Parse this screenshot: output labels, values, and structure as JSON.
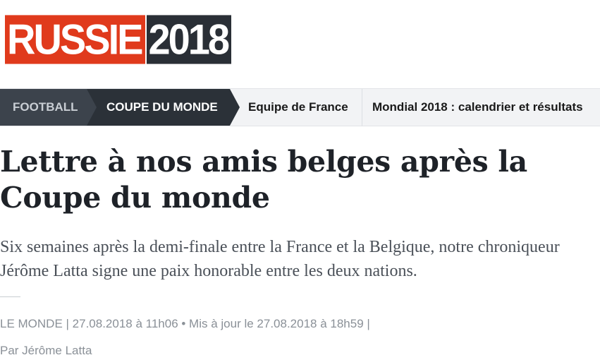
{
  "logo": {
    "part1": "RUSSIE",
    "part2": "2018",
    "colors": {
      "red": "#e03a1c",
      "dark": "#2a2f36"
    }
  },
  "nav": {
    "crumbs": [
      {
        "label": "FOOTBALL"
      },
      {
        "label": "COUPE DU MONDE"
      }
    ],
    "links": [
      {
        "label": "Equipe de France"
      },
      {
        "label": "Mondial 2018 : calendrier et résultats"
      }
    ]
  },
  "article": {
    "title": "Lettre à nos amis belges après la Coupe du monde",
    "subtitle": "Six semaines après la demi-finale entre la France et la Belgique, notre chroniqueur Jérôme Latta signe une paix honorable entre les deux nations.",
    "meta": "LE MONDE | 27.08.2018 à 11h06 • Mis à jour le 27.08.2018 à 18h59 |",
    "author": "Par Jérôme Latta"
  }
}
